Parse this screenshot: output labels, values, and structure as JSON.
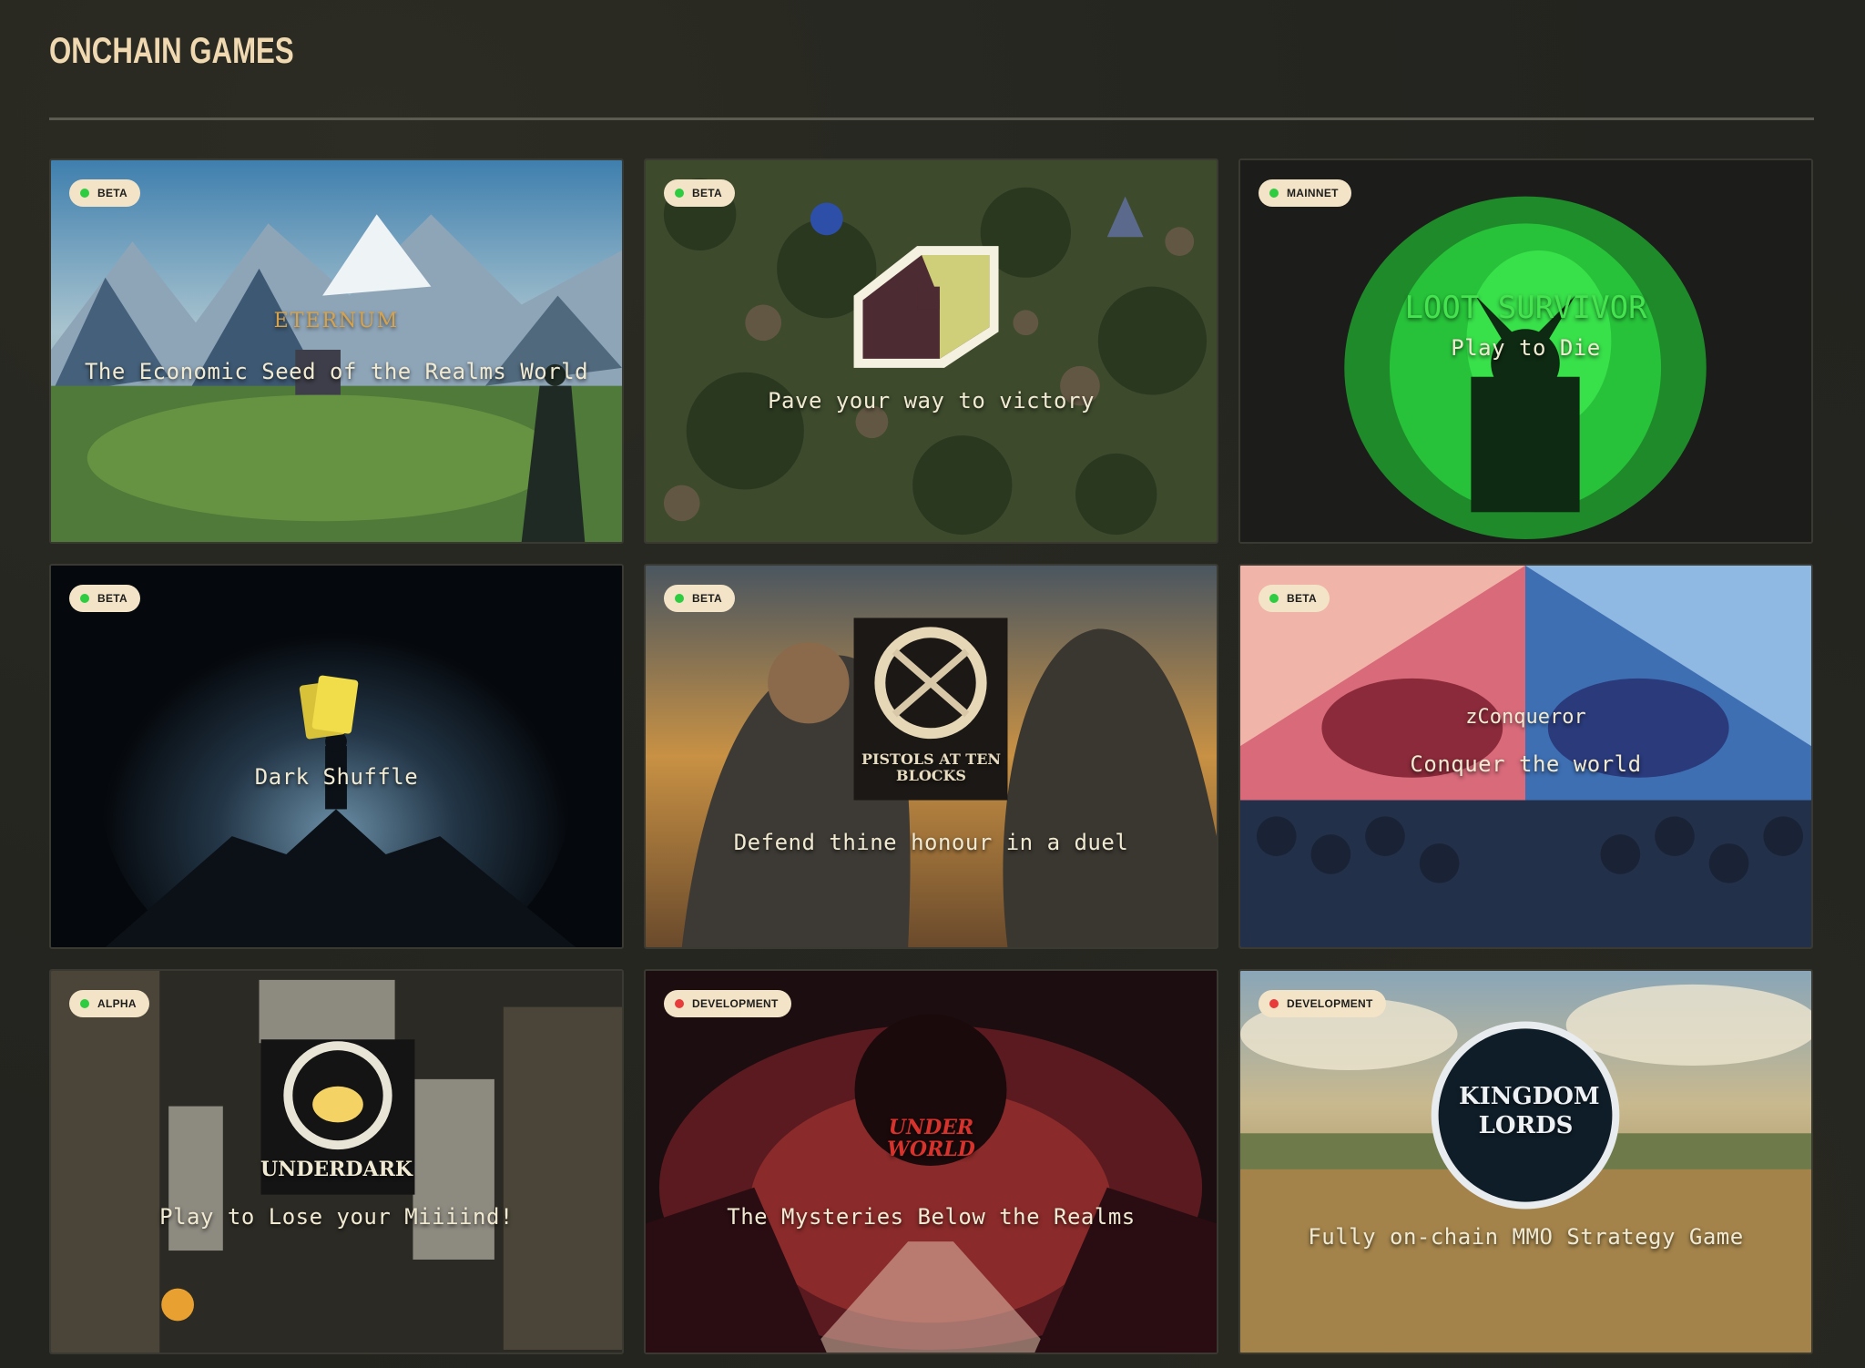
{
  "page": {
    "title": "ONCHAIN GAMES"
  },
  "colors": {
    "live": "#2ecc40",
    "dev": "#e83b3b",
    "badge_bg": "#f3e4c8"
  },
  "games": [
    {
      "status": "BETA",
      "status_color": "#2ecc40",
      "logo": "ETERNUM",
      "tagline": "The Economic Seed of the Realms World"
    },
    {
      "status": "BETA",
      "status_color": "#2ecc40",
      "logo": "",
      "tagline": "Pave your way to victory"
    },
    {
      "status": "MAINNET",
      "status_color": "#2ecc40",
      "logo": "LOOT SURVIVOR",
      "tagline": "Play to Die"
    },
    {
      "status": "BETA",
      "status_color": "#2ecc40",
      "logo": "",
      "tagline": "Dark Shuffle"
    },
    {
      "status": "BETA",
      "status_color": "#2ecc40",
      "logo": "PISTOLS AT TEN BLOCKS",
      "tagline": "Defend thine honour in a duel"
    },
    {
      "status": "BETA",
      "status_color": "#2ecc40",
      "logo": "zConqueror",
      "tagline": "Conquer the world"
    },
    {
      "status": "ALPHA",
      "status_color": "#2ecc40",
      "logo": "UNDERDARK",
      "tagline": "Play to Lose your Miiiind!"
    },
    {
      "status": "DEVELOPMENT",
      "status_color": "#e83b3b",
      "logo": "UNDER WORLD",
      "tagline": "The Mysteries Below the Realms"
    },
    {
      "status": "DEVELOPMENT",
      "status_color": "#e83b3b",
      "logo": "KINGDOM LORDS",
      "tagline": "Fully on-chain MMO Strategy Game"
    }
  ]
}
